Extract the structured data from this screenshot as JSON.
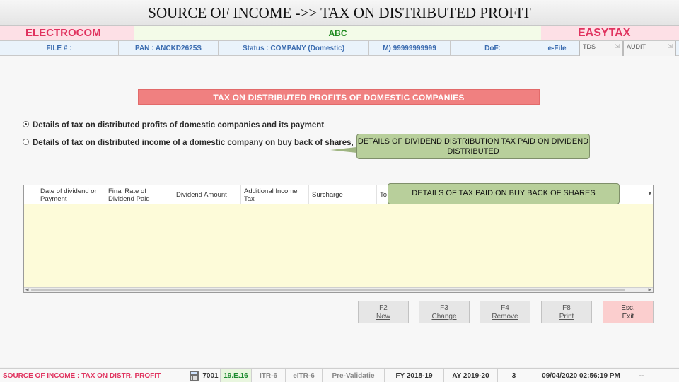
{
  "slide": {
    "title": "SOURCE OF INCOME ->> TAX ON DISTRIBUTED PROFIT"
  },
  "brand": {
    "left": "ELECTROCOM",
    "center": "ABC",
    "right": "EASYTAX"
  },
  "infobar": {
    "file": "FILE # :",
    "pan": "PAN : ANCKD2625S",
    "status": "Status : COMPANY (Domestic)",
    "mobile": "M) 99999999999",
    "dof": "DoF:",
    "efile": "e-File",
    "tabs": [
      {
        "label": "TDS",
        "pin": "⇲"
      },
      {
        "label": "AUDIT",
        "pin": "⇲"
      }
    ]
  },
  "section": {
    "heading": "TAX ON DISTRIBUTED PROFITS OF DOMESTIC COMPANIES"
  },
  "options": [
    {
      "label": "Details of tax on distributed profits of domestic companies and its payment",
      "selected": true
    },
    {
      "label": "Details of tax on distributed income of a domestic company on buy back of shares, not listed on stock exchange",
      "selected": false
    }
  ],
  "callouts": {
    "dividend": "DETAILS OF DIVIDEND DISTRIBUTION TAX PAID ON DIVIDEND DISTRIBUTED",
    "buyback": "DETAILS OF TAX PAID ON BUY BACK OF SHARES"
  },
  "grid": {
    "columns": [
      "Date of dividend or Payment",
      "Final Rate of Dividend Paid",
      "Dividend Amount",
      "Additional Income Tax",
      "Surcharge",
      "To"
    ],
    "sort_icon": "▾",
    "scroll_left": "◂",
    "scroll_right": "▸"
  },
  "function_keys": [
    {
      "key": "F2",
      "action": "New"
    },
    {
      "key": "F3",
      "action": "Change"
    },
    {
      "key": "F4",
      "action": "Remove"
    },
    {
      "key": "F8",
      "action": "Print"
    },
    {
      "key": "Esc.",
      "action": "Exit"
    }
  ],
  "statusbar": {
    "breadcrumb": "SOURCE OF INCOME : TAX ON DISTR. PROFIT",
    "code": "7001",
    "version": "19.E.16",
    "itr": "ITR-6",
    "eitr": "eITR-6",
    "prevalidate": "Pre-Validatie",
    "fy": "FY 2018-19",
    "ay": "AY 2019-20",
    "count": "3",
    "datetime": "09/04/2020 02:56:19 PM",
    "extra": "--"
  },
  "colors": {
    "brand_pink": "#e0335f",
    "heading_bg": "#f08080",
    "callout_bg": "#b8cf9b",
    "grid_bg": "#fdfad8",
    "link_blue": "#3b6cb0"
  }
}
